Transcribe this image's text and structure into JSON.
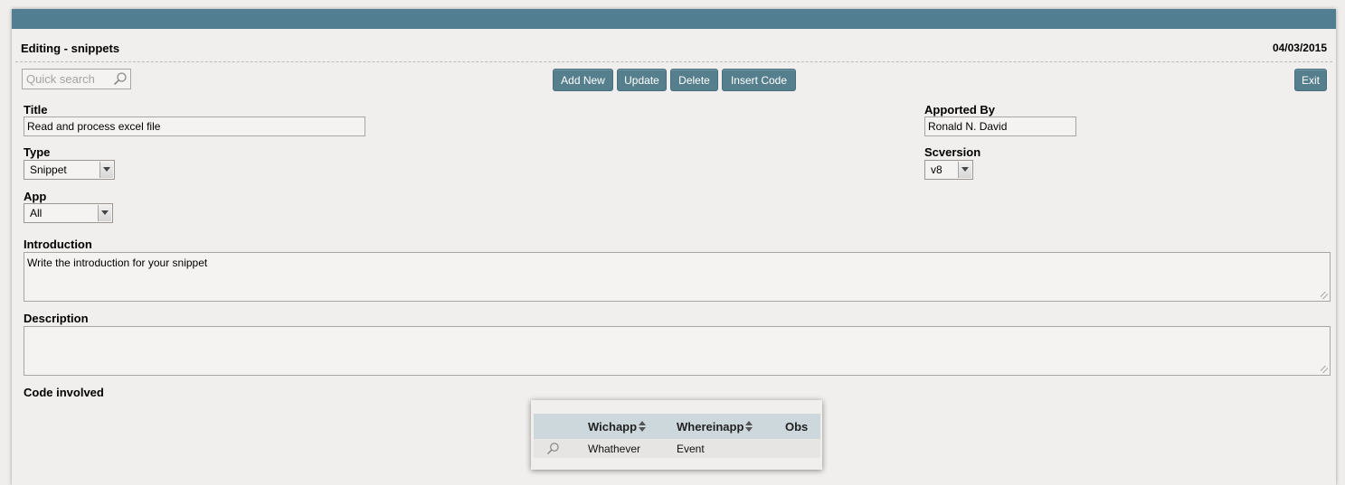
{
  "header": {
    "title": "Editing - snippets",
    "date": "04/03/2015"
  },
  "search": {
    "placeholder": "Quick search"
  },
  "toolbar": {
    "add_new": "Add New",
    "update": "Update",
    "delete": "Delete",
    "insert_code": "Insert Code",
    "exit": "Exit"
  },
  "form": {
    "title_label": "Title",
    "title_value": "Read and process excel file",
    "apported_by_label": "Apported By",
    "apported_by_value": "Ronald N. David",
    "type_label": "Type",
    "type_value": "Snippet",
    "scversion_label": "Scversion",
    "scversion_value": "v8",
    "app_label": "App",
    "app_value": "All",
    "introduction_label": "Introduction",
    "introduction_value": "Write the introduction for your snippet",
    "description_label": "Description",
    "description_value": "",
    "code_involved_label": "Code involved"
  },
  "grid": {
    "columns": [
      "Wichapp",
      "Whereinapp",
      "Obs"
    ],
    "rows": [
      {
        "wichapp": "Whathever",
        "whereinapp": "Event",
        "obs": ""
      }
    ]
  },
  "colors": {
    "header_bar": "#517f91",
    "button": "#567f8e",
    "grid_header": "#cdd8dc"
  }
}
